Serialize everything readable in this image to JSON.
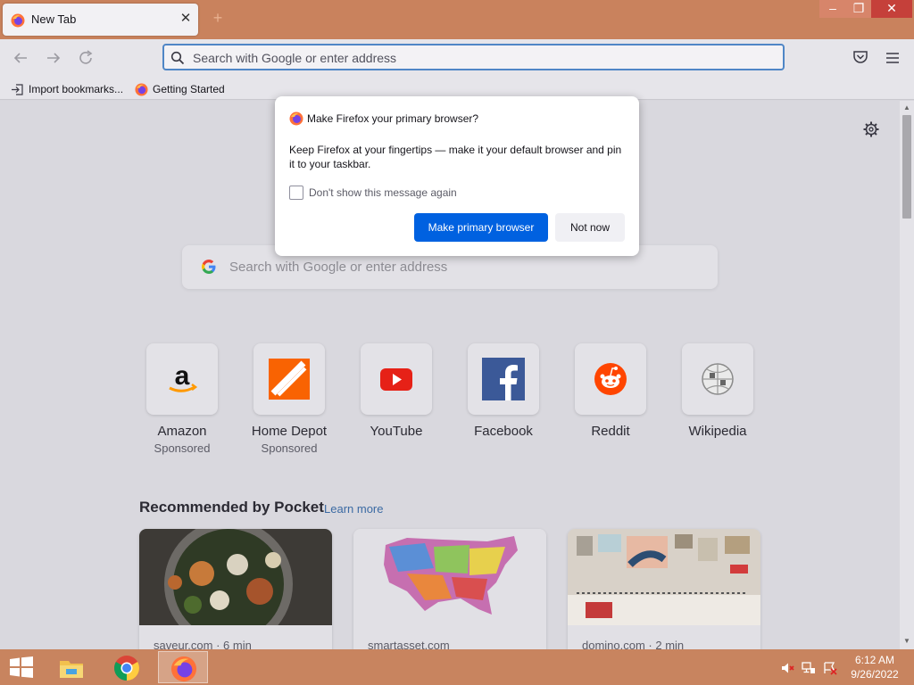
{
  "browser": {
    "tab": {
      "title": "New Tab",
      "close_glyph": "✕"
    },
    "new_tab_glyph": "+",
    "window_controls": {
      "minimize": "–",
      "maximize": "❐",
      "close": "✕"
    },
    "urlbar": {
      "placeholder": "Search with Google or enter address"
    },
    "bookmarks": [
      {
        "label": "Import bookmarks...",
        "icon": "import-icon"
      },
      {
        "label": "Getting Started",
        "icon": "firefox-icon"
      }
    ]
  },
  "newtab": {
    "search": {
      "placeholder": "Search with Google or enter address"
    },
    "top_sites": [
      {
        "name": "Amazon",
        "sponsored": "Sponsored",
        "icon": "amazon-icon"
      },
      {
        "name": "Home Depot",
        "sponsored": "Sponsored",
        "icon": "home-depot-icon"
      },
      {
        "name": "YouTube",
        "sponsored": "",
        "icon": "youtube-icon"
      },
      {
        "name": "Facebook",
        "sponsored": "",
        "icon": "facebook-icon"
      },
      {
        "name": "Reddit",
        "sponsored": "",
        "icon": "reddit-icon"
      },
      {
        "name": "Wikipedia",
        "sponsored": "",
        "icon": "wikipedia-icon"
      }
    ],
    "pocket": {
      "heading": "Recommended by Pocket",
      "learn_more": "Learn more",
      "cards": [
        {
          "source": "saveur.com · 6 min"
        },
        {
          "source": "smartasset.com"
        },
        {
          "source": "domino.com · 2 min"
        }
      ]
    }
  },
  "dialog": {
    "title": "Make Firefox your primary browser?",
    "body": "Keep Firefox at your fingertips — make it your default browser and pin it to your taskbar.",
    "checkbox_label": "Don't show this message again",
    "primary_button": "Make primary browser",
    "secondary_button": "Not now"
  },
  "taskbar": {
    "time": "6:12 AM",
    "date": "9/26/2022"
  },
  "colors": {
    "accent": "#0061e0",
    "taskbar": "#c8845f",
    "titlebar": "#c9825d"
  }
}
